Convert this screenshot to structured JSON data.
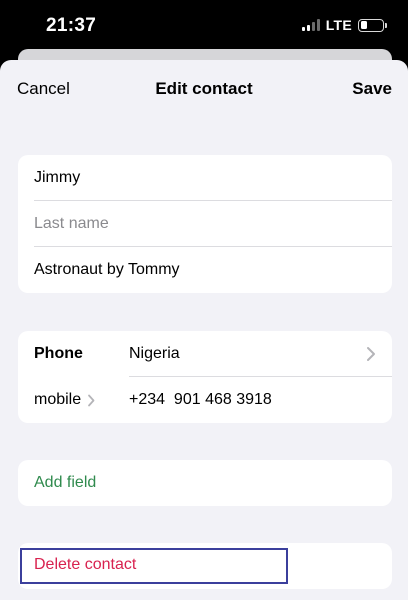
{
  "status_bar": {
    "time": "21:37",
    "network": "LTE"
  },
  "nav": {
    "cancel_label": "Cancel",
    "title": "Edit contact",
    "save_label": "Save"
  },
  "name_fields": {
    "first_name": "Jimmy",
    "last_name_placeholder": "Last name",
    "company": "Astronaut by Tommy"
  },
  "phone": {
    "label": "Phone",
    "country": "Nigeria",
    "type_label": "mobile",
    "number": "+234  901 468 3918"
  },
  "add_field_label": "Add field",
  "delete_label": "Delete contact",
  "colors": {
    "sheet_background": "#f2f2f7",
    "add_field": "#2f8a4d",
    "delete": "#d8224f",
    "highlight": "#3b3f9c"
  },
  "icons": {
    "country_chevron": "chevron-right-icon",
    "type_chevron": "chevron-right-icon"
  }
}
